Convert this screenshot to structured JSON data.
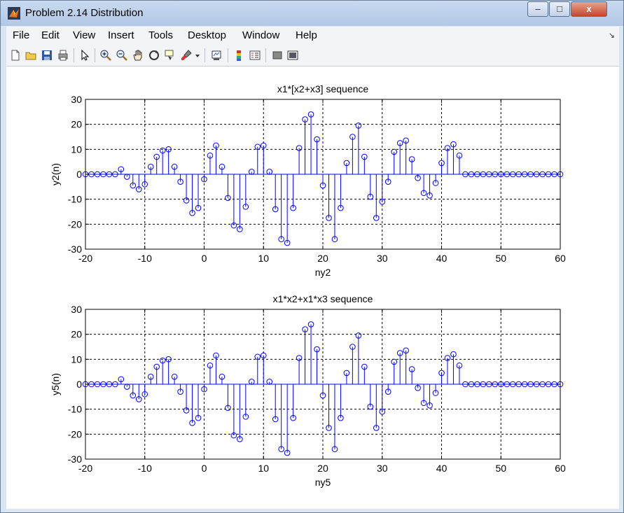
{
  "window": {
    "title": "Problem 2.14 Distribution",
    "buttons": [
      "–",
      "□",
      "x"
    ]
  },
  "menu": [
    "File",
    "Edit",
    "View",
    "Insert",
    "Tools",
    "Desktop",
    "Window",
    "Help"
  ],
  "menu_arrow": "↘",
  "toolbar_icons": [
    "new-figure-icon",
    "open-file-icon",
    "save-icon",
    "print-icon",
    "pointer-icon",
    "zoom-in-icon",
    "zoom-out-icon",
    "pan-icon",
    "rotate-3d-icon",
    "data-cursor-icon",
    "brush-icon",
    "brush-dropdown-icon",
    "link-plot-icon",
    "colorbar-icon",
    "legend-icon",
    "hide-plot-tools-icon",
    "show-plot-tools-icon"
  ],
  "colors": {
    "stem": "#0000ff",
    "baseline": "#0000ff",
    "grid": "#000000"
  },
  "chart_data": [
    {
      "type": "stem",
      "title": "x1*[x2+x3] sequence",
      "xlabel": "ny2",
      "ylabel": "y2(n)",
      "xlim": [
        -20,
        60
      ],
      "ylim": [
        -30,
        30
      ],
      "xticks": [
        -20,
        -10,
        0,
        10,
        20,
        30,
        40,
        50,
        60
      ],
      "yticks": [
        30,
        20,
        10,
        0,
        -10,
        -20,
        -30
      ],
      "grid": true,
      "x": [
        -20,
        -19,
        -18,
        -17,
        -16,
        -15,
        -14,
        -13,
        -12,
        -11,
        -10,
        -9,
        -8,
        -7,
        -6,
        -5,
        -4,
        -3,
        -2,
        -1,
        0,
        1,
        2,
        3,
        4,
        5,
        6,
        7,
        8,
        9,
        10,
        11,
        12,
        13,
        14,
        15,
        16,
        17,
        18,
        19,
        20,
        21,
        22,
        23,
        24,
        25,
        26,
        27,
        28,
        29,
        30,
        31,
        32,
        33,
        34,
        35,
        36,
        37,
        38,
        39,
        40,
        41,
        42,
        43,
        44,
        45,
        46,
        47,
        48,
        49,
        50,
        51,
        52,
        53,
        54,
        55,
        56,
        57,
        58,
        59,
        60
      ],
      "y": [
        0,
        0,
        0,
        0,
        0,
        0,
        2,
        -1,
        -4.5,
        -6,
        -4,
        3,
        7,
        9.5,
        10,
        3,
        -3,
        -10.5,
        -15.5,
        -13.5,
        -2,
        7.5,
        11.5,
        3,
        -9.5,
        -20.5,
        -22,
        -13,
        1,
        11,
        11.5,
        1,
        -14,
        -26,
        -27.5,
        -13.5,
        10.5,
        22,
        24,
        14,
        -4.5,
        -17.5,
        -26,
        -13.5,
        4.5,
        15,
        19.5,
        7,
        -9,
        -17.5,
        -11,
        -3,
        9,
        12.5,
        13.5,
        6,
        -1.5,
        -7.5,
        -8.5,
        -3.5,
        4.5,
        10.5,
        12,
        7.5,
        0,
        0,
        0,
        0,
        0,
        0,
        0,
        0,
        0,
        0,
        0,
        0,
        0,
        0,
        0,
        0,
        0
      ]
    },
    {
      "type": "stem",
      "title": "x1*x2+x1*x3 sequence",
      "xlabel": "ny5",
      "ylabel": "y5(n)",
      "xlim": [
        -20,
        60
      ],
      "ylim": [
        -30,
        30
      ],
      "xticks": [
        -20,
        -10,
        0,
        10,
        20,
        30,
        40,
        50,
        60
      ],
      "yticks": [
        30,
        20,
        10,
        0,
        -10,
        -20,
        -30
      ],
      "grid": true,
      "x": [
        -20,
        -19,
        -18,
        -17,
        -16,
        -15,
        -14,
        -13,
        -12,
        -11,
        -10,
        -9,
        -8,
        -7,
        -6,
        -5,
        -4,
        -3,
        -2,
        -1,
        0,
        1,
        2,
        3,
        4,
        5,
        6,
        7,
        8,
        9,
        10,
        11,
        12,
        13,
        14,
        15,
        16,
        17,
        18,
        19,
        20,
        21,
        22,
        23,
        24,
        25,
        26,
        27,
        28,
        29,
        30,
        31,
        32,
        33,
        34,
        35,
        36,
        37,
        38,
        39,
        40,
        41,
        42,
        43,
        44,
        45,
        46,
        47,
        48,
        49,
        50,
        51,
        52,
        53,
        54,
        55,
        56,
        57,
        58,
        59,
        60
      ],
      "y": [
        0,
        0,
        0,
        0,
        0,
        0,
        2,
        -1,
        -4.5,
        -6,
        -4,
        3,
        7,
        9.5,
        10,
        3,
        -3,
        -10.5,
        -15.5,
        -13.5,
        -2,
        7.5,
        11.5,
        3,
        -9.5,
        -20.5,
        -22,
        -13,
        1,
        11,
        11.5,
        1,
        -14,
        -26,
        -27.5,
        -13.5,
        10.5,
        22,
        24,
        14,
        -4.5,
        -17.5,
        -26,
        -13.5,
        4.5,
        15,
        19.5,
        7,
        -9,
        -17.5,
        -11,
        -3,
        9,
        12.5,
        13.5,
        6,
        -1.5,
        -7.5,
        -8.5,
        -3.5,
        4.5,
        10.5,
        12,
        7.5,
        0,
        0,
        0,
        0,
        0,
        0,
        0,
        0,
        0,
        0,
        0,
        0,
        0,
        0,
        0,
        0,
        0
      ]
    }
  ]
}
